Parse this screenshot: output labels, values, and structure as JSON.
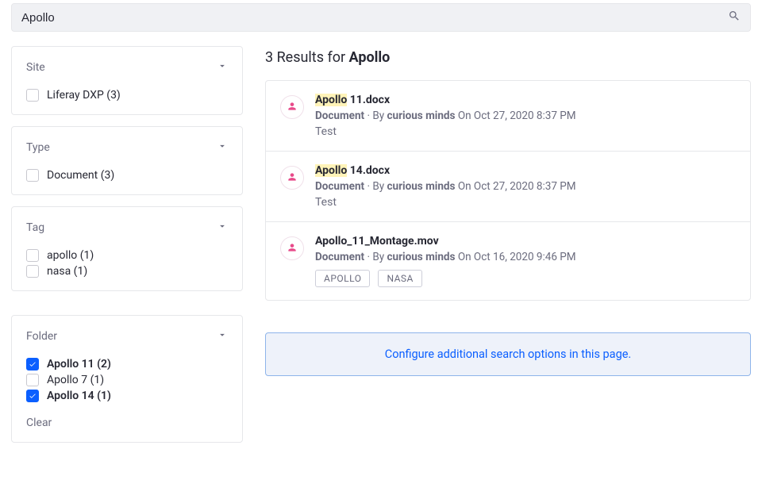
{
  "search": {
    "value": "Apollo",
    "placeholder": ""
  },
  "results_header": {
    "count_text": "3 Results for ",
    "query": "Apollo"
  },
  "facets": {
    "site": {
      "title": "Site",
      "items": [
        {
          "label": "Liferay DXP (3)",
          "checked": false
        }
      ]
    },
    "type": {
      "title": "Type",
      "items": [
        {
          "label": "Document (3)",
          "checked": false
        }
      ]
    },
    "tag": {
      "title": "Tag",
      "items": [
        {
          "label": "apollo (1)",
          "checked": false
        },
        {
          "label": "nasa (1)",
          "checked": false
        }
      ]
    },
    "folder": {
      "title": "Folder",
      "items": [
        {
          "label": "Apollo 11 (2)",
          "checked": true
        },
        {
          "label": "Apollo 7 (1)",
          "checked": false
        },
        {
          "label": "Apollo 14 (1)",
          "checked": true
        }
      ],
      "clear": "Clear"
    }
  },
  "results": [
    {
      "title_hl": "Apollo",
      "title_rest": " 11.docx",
      "type": "Document",
      "author": "curious minds",
      "date": "On Oct 27, 2020 8:37 PM",
      "snippet": "Test",
      "tags": []
    },
    {
      "title_hl": "Apollo",
      "title_rest": " 14.docx",
      "type": "Document",
      "author": "curious minds",
      "date": "On Oct 27, 2020 8:37 PM",
      "snippet": "Test",
      "tags": []
    },
    {
      "title_hl": "",
      "title_rest": "Apollo_11_Montage.mov",
      "type": "Document",
      "author": "curious minds",
      "date": "On Oct 16, 2020 9:46 PM",
      "snippet": "",
      "tags": [
        "APOLLO",
        "NASA"
      ]
    }
  ],
  "meta_labels": {
    "dot": " · ",
    "by": "By "
  },
  "config_banner": "Configure additional search options in this page."
}
